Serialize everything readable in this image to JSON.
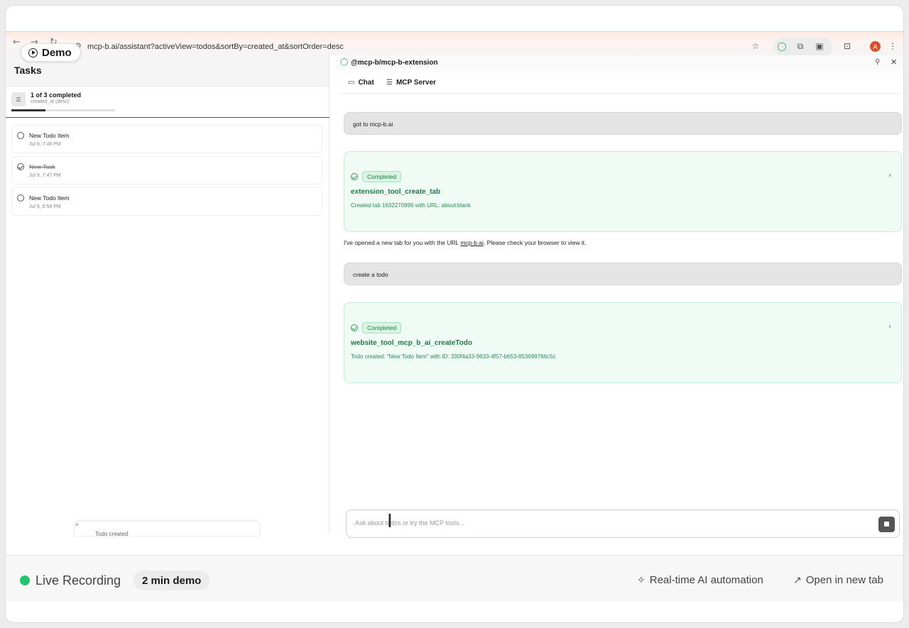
{
  "demo": {
    "label": "Demo"
  },
  "browser": {
    "url": "mcp-b.ai/assistant?activeView=todos&sortBy=created_at&sortOrder=desc",
    "avatar_letter": "A"
  },
  "tasks": {
    "title": "Tasks",
    "progress_label": "1 of 3 completed",
    "sort_label": "created_at (desc)",
    "progress": 0.33,
    "items": [
      {
        "title": "New Todo Item",
        "time": "Jul 9, 7:48 PM",
        "done": false
      },
      {
        "title": "New Task",
        "time": "Jul 9, 7:47 PM",
        "done": true
      },
      {
        "title": "New Todo Item",
        "time": "Jul 9, 6:58 PM",
        "done": false
      }
    ],
    "toast": {
      "close": "×",
      "message": "Todo created"
    }
  },
  "panel": {
    "title": "@mcp-b/mcp-b-extension",
    "tabs": {
      "chat": "Chat",
      "server": "MCP Server"
    },
    "messages": {
      "user1": "got to mcp-b.ai",
      "tool1": {
        "status": "Completed",
        "name": "extension_tool_create_tab",
        "result": "Created tab 1632270996 with URL: about:blank"
      },
      "assistant_pre": "I've opened a new tab for you with the URL ",
      "assistant_link": "mcp-b.ai",
      "assistant_post": ". Please check your browser to view it.",
      "user2": "create a todo",
      "tool2": {
        "status": "Completed",
        "name": "website_tool_mcp_b_ai_createTodo",
        "result": "Todo created: \"New Todo Item\" with ID: 330f4a33-9633-4f57-b653-853699766c5c"
      }
    },
    "input_placeholder": "Ask about todos or try the MCP tools..."
  },
  "footer": {
    "live": "Live Recording",
    "duration": "2 min demo",
    "realtime": "Real-time AI automation",
    "open": "Open in new tab"
  },
  "colors": {
    "accent_green": "#2a9a5a",
    "live_dot": "#26c36b",
    "avatar": "#d9502e"
  }
}
